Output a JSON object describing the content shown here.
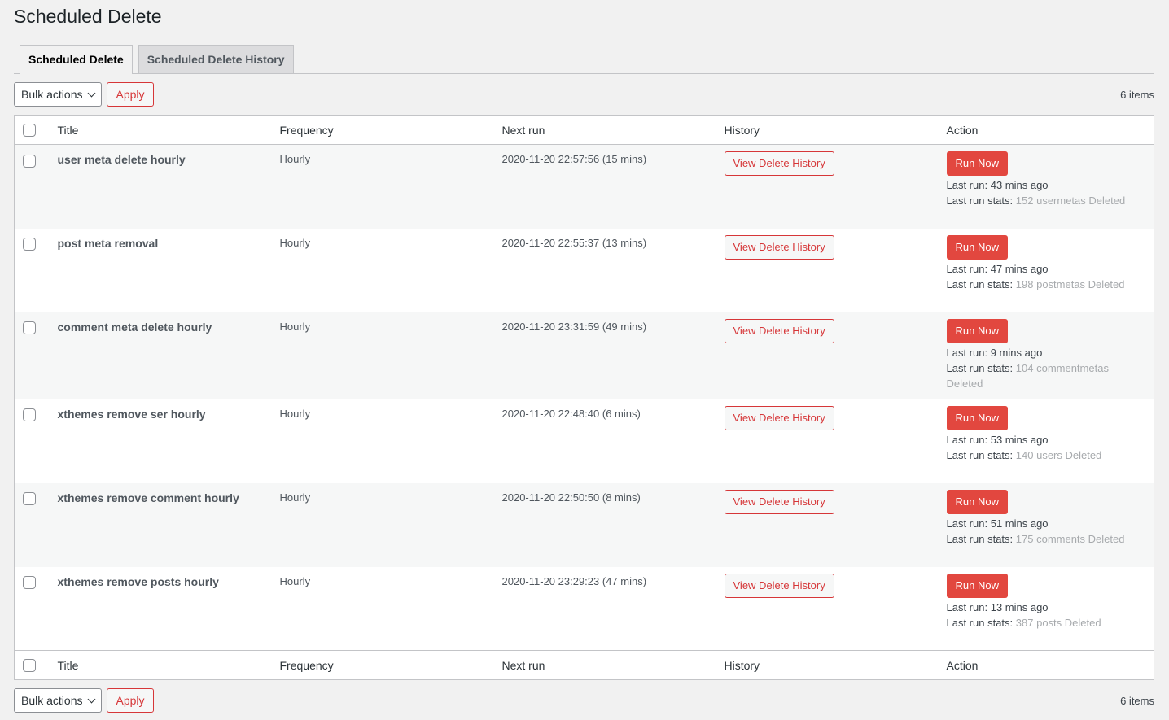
{
  "page": {
    "title": "Scheduled Delete"
  },
  "tabs": [
    {
      "label": "Scheduled Delete",
      "active": true
    },
    {
      "label": "Scheduled Delete History",
      "active": false
    }
  ],
  "tablenav_top": {
    "bulk_actions": "Bulk actions",
    "apply": "Apply",
    "items_count": "6 items"
  },
  "tablenav_bottom": {
    "bulk_actions": "Bulk actions",
    "apply": "Apply",
    "items_count": "6 items"
  },
  "table": {
    "columns": [
      "Title",
      "Frequency",
      "Next run",
      "History",
      "Action"
    ],
    "view_history_label": "View Delete History",
    "run_now_label": "Run Now",
    "last_run_prefix": "Last run:",
    "last_run_stats_prefix": "Last run stats:",
    "rows": [
      {
        "title": "user meta delete hourly",
        "frequency": "Hourly",
        "next_run": "2020-11-20 22:57:56 (15 mins)",
        "last_run": "43 mins ago",
        "last_run_stats": "152 usermetas Deleted"
      },
      {
        "title": "post meta removal",
        "frequency": "Hourly",
        "next_run": "2020-11-20 22:55:37 (13 mins)",
        "last_run": "47 mins ago",
        "last_run_stats": "198 postmetas Deleted"
      },
      {
        "title": "comment meta delete hourly",
        "frequency": "Hourly",
        "next_run": "2020-11-20 23:31:59 (49 mins)",
        "last_run": "9 mins ago",
        "last_run_stats": "104 commentmetas Deleted"
      },
      {
        "title": "xthemes remove ser hourly",
        "frequency": "Hourly",
        "next_run": "2020-11-20 22:48:40 (6 mins)",
        "last_run": "53 mins ago",
        "last_run_stats": "140 users Deleted"
      },
      {
        "title": "xthemes remove comment hourly",
        "frequency": "Hourly",
        "next_run": "2020-11-20 22:50:50 (8 mins)",
        "last_run": "51 mins ago",
        "last_run_stats": "175 comments Deleted"
      },
      {
        "title": "xthemes remove posts hourly",
        "frequency": "Hourly",
        "next_run": "2020-11-20 23:29:23 (47 mins)",
        "last_run": "13 mins ago",
        "last_run_stats": "387 posts Deleted"
      }
    ]
  },
  "colors": {
    "accent_red": "#d63638",
    "run_button_bg": "#e2473f",
    "faded_stats": "#a7aaad",
    "background": "#f1f1f1"
  }
}
